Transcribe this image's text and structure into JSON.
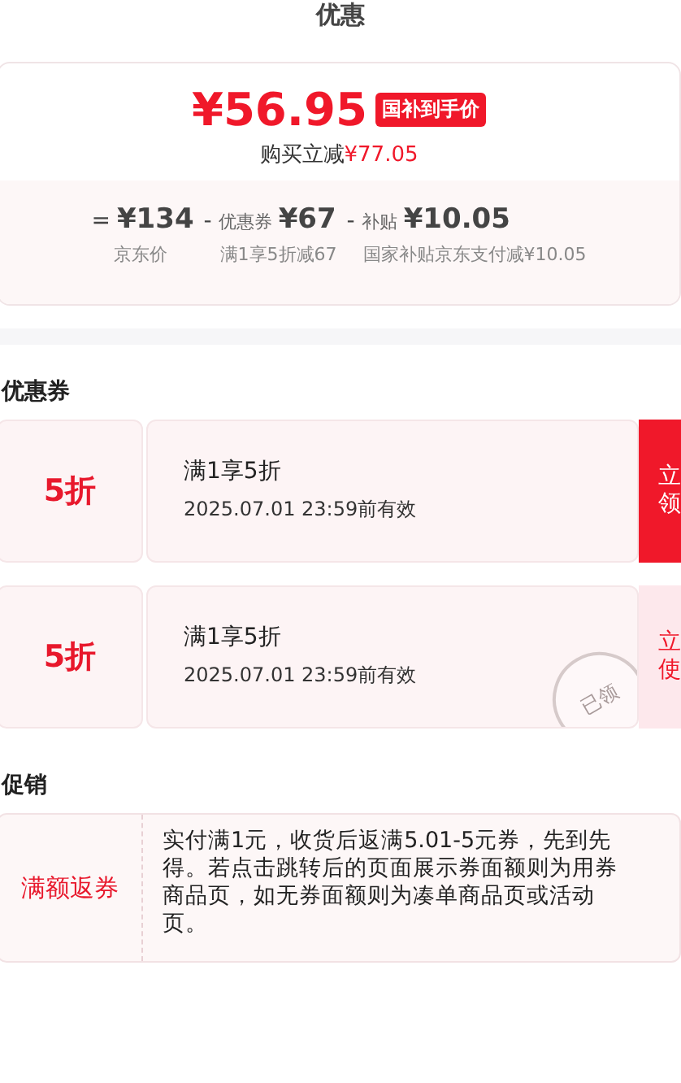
{
  "title": "优惠",
  "price_card": {
    "price": "¥56.95",
    "price_tag": "国补到手价",
    "saving_label": "购买立减",
    "saving_amount": "¥77.05",
    "breakdown": [
      {
        "kind": "base",
        "sign": "=",
        "amount": "¥134",
        "note": "京东价"
      },
      {
        "kind": "minus",
        "sign": "-",
        "label": "优惠券",
        "amount": "¥67",
        "note": "满1享5折减67"
      },
      {
        "kind": "minus",
        "sign": "-",
        "label": "补贴",
        "amount": "¥10.05",
        "note": "国家补贴京东支付减¥10.05"
      }
    ]
  },
  "coupons_heading": "优惠券",
  "coupons": [
    {
      "value": "5折",
      "condition": "满1享5折",
      "validity": "2025.07.01 23:59前有效",
      "button": [
        "立",
        "领"
      ],
      "claimed": false
    },
    {
      "value": "5折",
      "condition": "满1享5折",
      "validity": "2025.07.01 23:59前有效",
      "button": [
        "立",
        "使"
      ],
      "claimed": true,
      "stamp": "已领"
    }
  ],
  "promotions_heading": "促销",
  "promotions": [
    {
      "tag": "满额返券",
      "text": "实付满1元，收货后返满5.01-5元券，先到先得。若点击跳转后的页面展示券面额则为用券商品页，如无券面额则为凑单商品页或活动页。"
    }
  ]
}
